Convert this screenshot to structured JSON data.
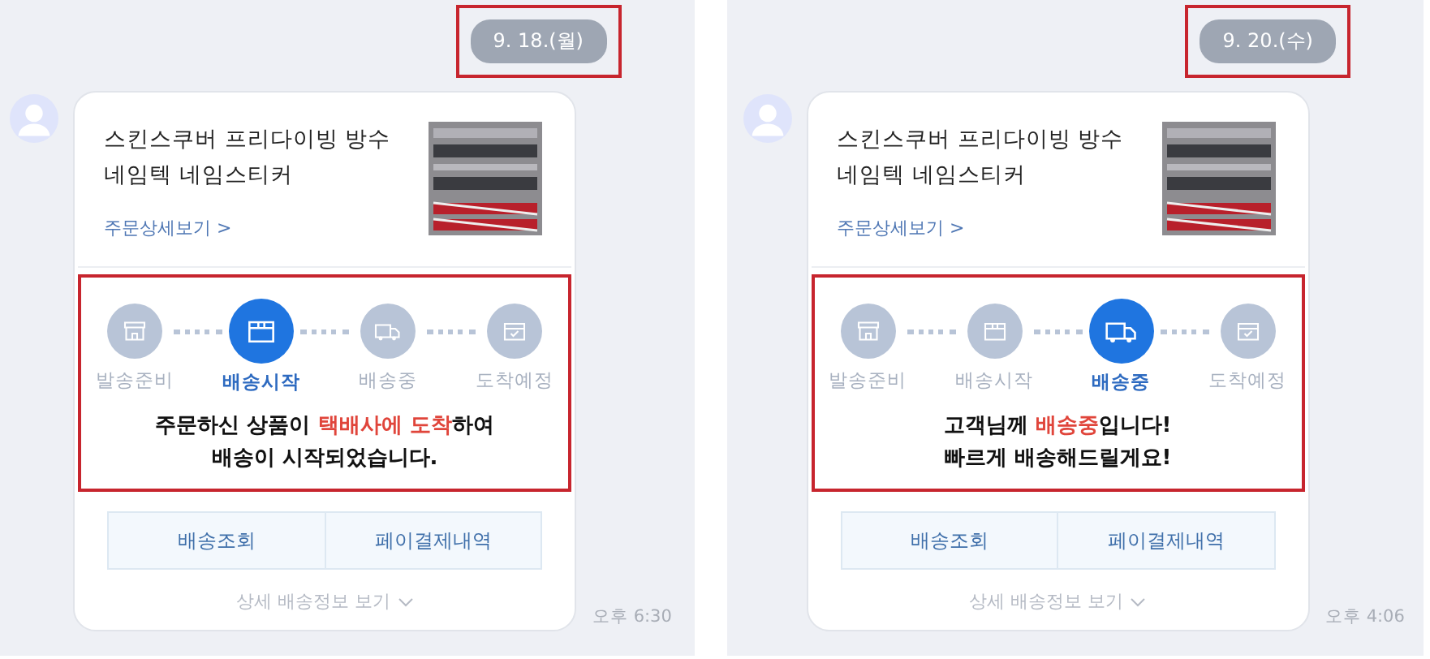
{
  "chats": [
    {
      "date": {
        "text": "9. 18.(월)",
        "highlighted": true
      },
      "card": {
        "product_title": "스킨스쿠버 프리다이빙 방수 네임텍 네임스티커",
        "image": {
          "kind": "picture"
        },
        "order_link": "주문상세보기 >",
        "tracker": {
          "highlighted": true,
          "steps": [
            {
              "label": "발송준비",
              "kind": "store",
              "selected": false
            },
            {
              "label": "배송시작",
              "kind": "box",
              "selected": true
            },
            {
              "label": "배송중",
              "kind": "truck",
              "selected": false
            },
            {
              "label": "도착예정",
              "kind": "calendar",
              "selected": false
            }
          ],
          "message": [
            [
              {
                "text": "주문하신 상품이 ",
                "highlight": false
              },
              {
                "text": "택배사에 도착",
                "highlight": true
              },
              {
                "text": "하여",
                "highlight": false
              }
            ],
            [
              {
                "text": "배송이 시작되었습니다.",
                "highlight": false
              }
            ]
          ]
        },
        "buttons": [
          "배송조회",
          "페이결제내역"
        ],
        "details_link": "상세 배송정보 보기"
      },
      "time": "오후 6:30"
    },
    {
      "date": {
        "text": "9. 20.(수)",
        "highlighted": true
      },
      "card": {
        "product_title": "스킨스쿠버 프리다이빙 방수 네임텍 네임스티커",
        "image": {
          "kind": "picture"
        },
        "order_link": "주문상세보기 >",
        "tracker": {
          "highlighted": true,
          "steps": [
            {
              "label": "발송준비",
              "kind": "store",
              "selected": false
            },
            {
              "label": "배송시작",
              "kind": "box",
              "selected": false
            },
            {
              "label": "배송중",
              "kind": "truck",
              "selected": true
            },
            {
              "label": "도착예정",
              "kind": "calendar",
              "selected": false
            }
          ],
          "message": [
            [
              {
                "text": "고객님께 ",
                "highlight": false
              },
              {
                "text": "배송중",
                "highlight": true
              },
              {
                "text": "입니다!",
                "highlight": false
              }
            ],
            [
              {
                "text": "빠르게 배송해드릴게요!",
                "highlight": false
              }
            ]
          ]
        },
        "buttons": [
          "배송조회",
          "페이결제내역"
        ],
        "details_link": "상세 배송정보 보기"
      },
      "time": "오후 4:06"
    }
  ]
}
